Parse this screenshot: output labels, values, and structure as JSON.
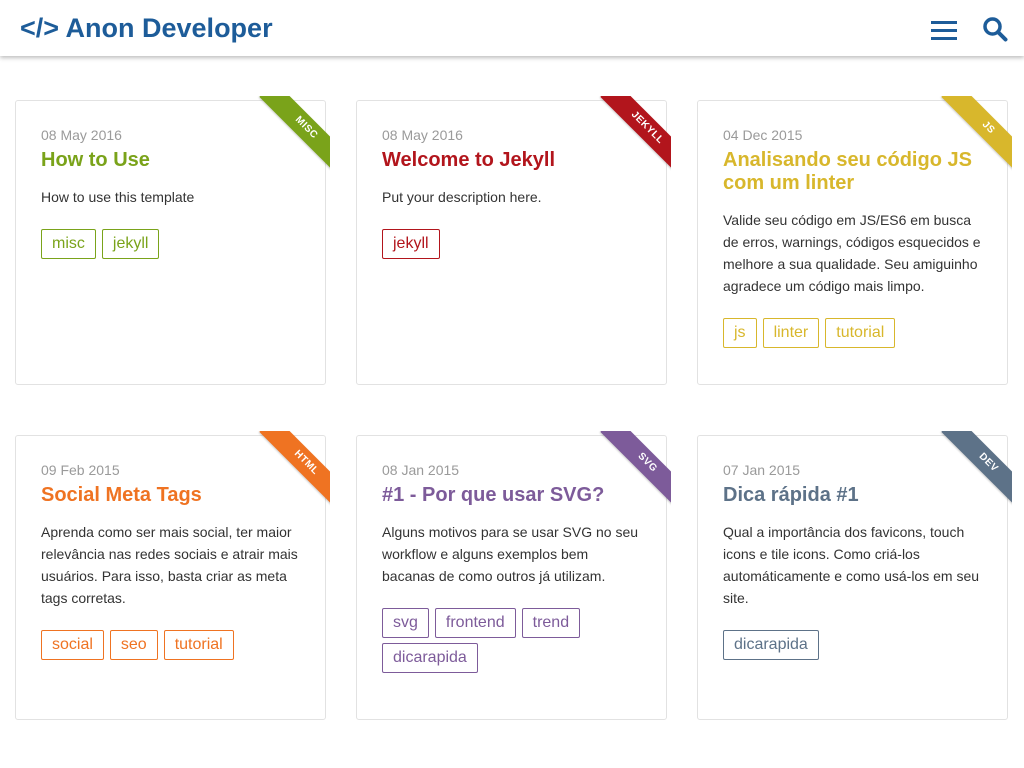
{
  "header": {
    "logo": "</> Anon Developer",
    "brand_color": "#1d5c99"
  },
  "posts": [
    {
      "date": "08 May 2016",
      "title": "How to Use",
      "description": "How to use this template",
      "category": "MISC",
      "color": "#7aa31a",
      "tags": [
        "misc",
        "jekyll"
      ]
    },
    {
      "date": "08 May 2016",
      "title": "Welcome to Jekyll",
      "description": "Put your description here.",
      "category": "JEKYLL",
      "color": "#b2151c",
      "tags": [
        "jekyll"
      ]
    },
    {
      "date": "04 Dec 2015",
      "title": "Analisando seu código JS com um linter",
      "description": "Valide seu código em JS/ES6 em busca de erros, warnings, códigos esquecidos e melhore a sua qualidade. Seu amiguinho agradece um código mais limpo.",
      "category": "JS",
      "color": "#d8b72c",
      "tags": [
        "js",
        "linter",
        "tutorial"
      ]
    },
    {
      "date": "09 Feb 2015",
      "title": "Social Meta Tags",
      "description": "Aprenda como ser mais social, ter maior relevância nas redes sociais e atrair mais usuários. Para isso, basta criar as meta tags corretas.",
      "category": "HTML",
      "color": "#ef7322",
      "tags": [
        "social",
        "seo",
        "tutorial"
      ]
    },
    {
      "date": "08 Jan 2015",
      "title": "#1 - Por que usar SVG?",
      "description": "Alguns motivos para se usar SVG no seu workflow e alguns exemplos bem bacanas de como outros já utilizam.",
      "category": "SVG",
      "color": "#7d5b9a",
      "tags": [
        "svg",
        "frontend",
        "trend",
        "dicarapida"
      ]
    },
    {
      "date": "07 Jan 2015",
      "title": "Dica rápida #1",
      "description": "Qual a importância dos favicons, touch icons e tile icons. Como criá-los automáticamente e como usá-los em seu site.",
      "category": "DEV",
      "color": "#5d7288",
      "tags": [
        "dicarapida"
      ]
    }
  ]
}
